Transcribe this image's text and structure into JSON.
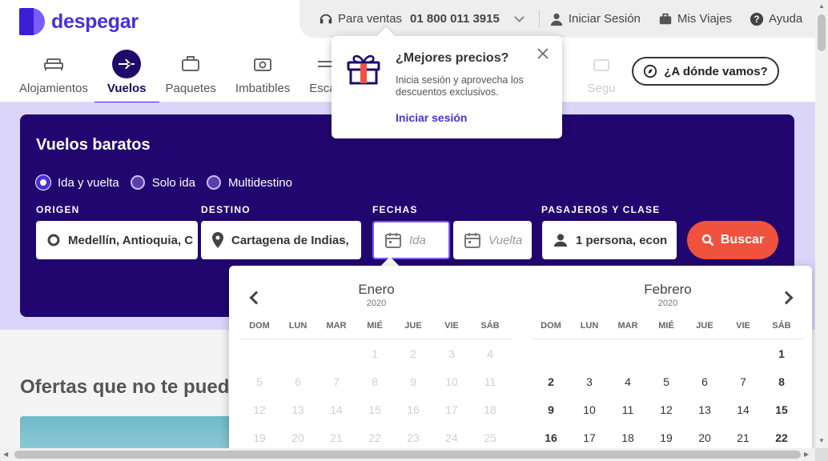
{
  "brand": {
    "name": "despegar"
  },
  "topbar": {
    "phone_prefix": "Para ventas",
    "phone_number": "01 800 011 3915",
    "login": "Iniciar Sesión",
    "trips": "Mis Viajes",
    "help": "Ayuda"
  },
  "nav": [
    {
      "label": "Alojamientos",
      "icon": "bed-icon",
      "active": false
    },
    {
      "label": "Vuelos",
      "icon": "plane-icon",
      "active": true
    },
    {
      "label": "Paquetes",
      "icon": "suitcase-icon",
      "active": false
    },
    {
      "label": "Imbatibles",
      "icon": "badge-icon",
      "active": false
    },
    {
      "label": "Escap",
      "icon": "getaway-icon",
      "active": false
    },
    {
      "label": "Segu",
      "icon": "insurance-icon",
      "active": false
    }
  ],
  "where_button": "¿A dónde vamos?",
  "popup": {
    "title": "¿Mejores precios?",
    "text": "Inicia sesión y aprovecha los descuentos exclusivos.",
    "link": "Iniciar sesión"
  },
  "search": {
    "title": "Vuelos baratos",
    "trip_types": [
      "Ida y vuelta",
      "Solo ida",
      "Multidestino"
    ],
    "selected_trip_type": "Ida y vuelta",
    "labels": {
      "origin": "ORIGEN",
      "destination": "DESTINO",
      "dates": "FECHAS",
      "passengers": "PASAJEROS Y CLASE"
    },
    "origin_value": "Medellín, Antioquia, C",
    "destination_value": "Cartagena de Indias, ",
    "depart_placeholder": "Ida",
    "return_placeholder": "Vuelta",
    "passengers_value": "1 persona, econ",
    "button": "Buscar"
  },
  "offers_heading": "Ofertas que no te pued",
  "calendar": {
    "dow": [
      "DOM",
      "LUN",
      "MAR",
      "MIÉ",
      "JUE",
      "VIE",
      "SÁB"
    ],
    "months": [
      {
        "name": "Enero",
        "year": "2020",
        "weeks": [
          [
            "",
            "",
            "",
            "1",
            "2",
            "3",
            "4"
          ],
          [
            "5",
            "6",
            "7",
            "8",
            "9",
            "10",
            "11"
          ],
          [
            "12",
            "13",
            "14",
            "15",
            "16",
            "17",
            "18"
          ],
          [
            "19",
            "20",
            "21",
            "22",
            "23",
            "24",
            "25"
          ]
        ]
      },
      {
        "name": "Febrero",
        "year": "2020",
        "weeks": [
          [
            "",
            "",
            "",
            "",
            "",
            "",
            "1"
          ],
          [
            "2",
            "3",
            "4",
            "5",
            "6",
            "7",
            "8"
          ],
          [
            "9",
            "10",
            "11",
            "12",
            "13",
            "14",
            "15"
          ],
          [
            "16",
            "17",
            "18",
            "19",
            "20",
            "21",
            "22"
          ]
        ]
      }
    ]
  },
  "colors": {
    "brand": "#4a2fd6",
    "card": "#22066f",
    "band": "#dcd5fa",
    "search_button": "#f0523d"
  }
}
